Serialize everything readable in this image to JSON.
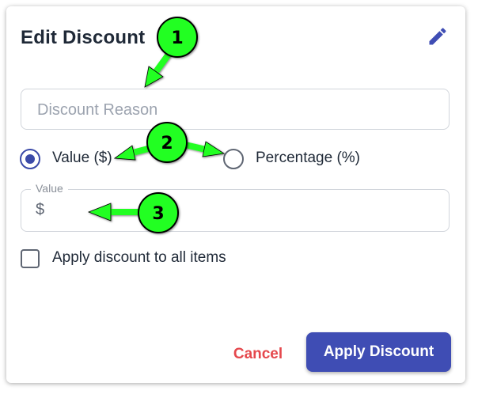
{
  "dialog": {
    "title": "Edit Discount",
    "edit_icon": "pencil-icon"
  },
  "reason": {
    "placeholder": "Discount Reason",
    "value": ""
  },
  "discount_type": {
    "options": [
      {
        "label": "Value ($)",
        "selected": true
      },
      {
        "label": "Percentage (%)",
        "selected": false
      }
    ]
  },
  "value_field": {
    "label": "Value",
    "prefix": "$",
    "value": ""
  },
  "apply_all": {
    "label": "Apply discount to all items",
    "checked": false
  },
  "actions": {
    "cancel_label": "Cancel",
    "apply_label": "Apply Discount"
  },
  "annotations": [
    {
      "number": "1"
    },
    {
      "number": "2"
    },
    {
      "number": "3"
    }
  ],
  "colors": {
    "accent": "#3f4db4",
    "cancel": "#e5484d",
    "annotation_fill": "#22ff22",
    "arrow": "#22ff22"
  }
}
